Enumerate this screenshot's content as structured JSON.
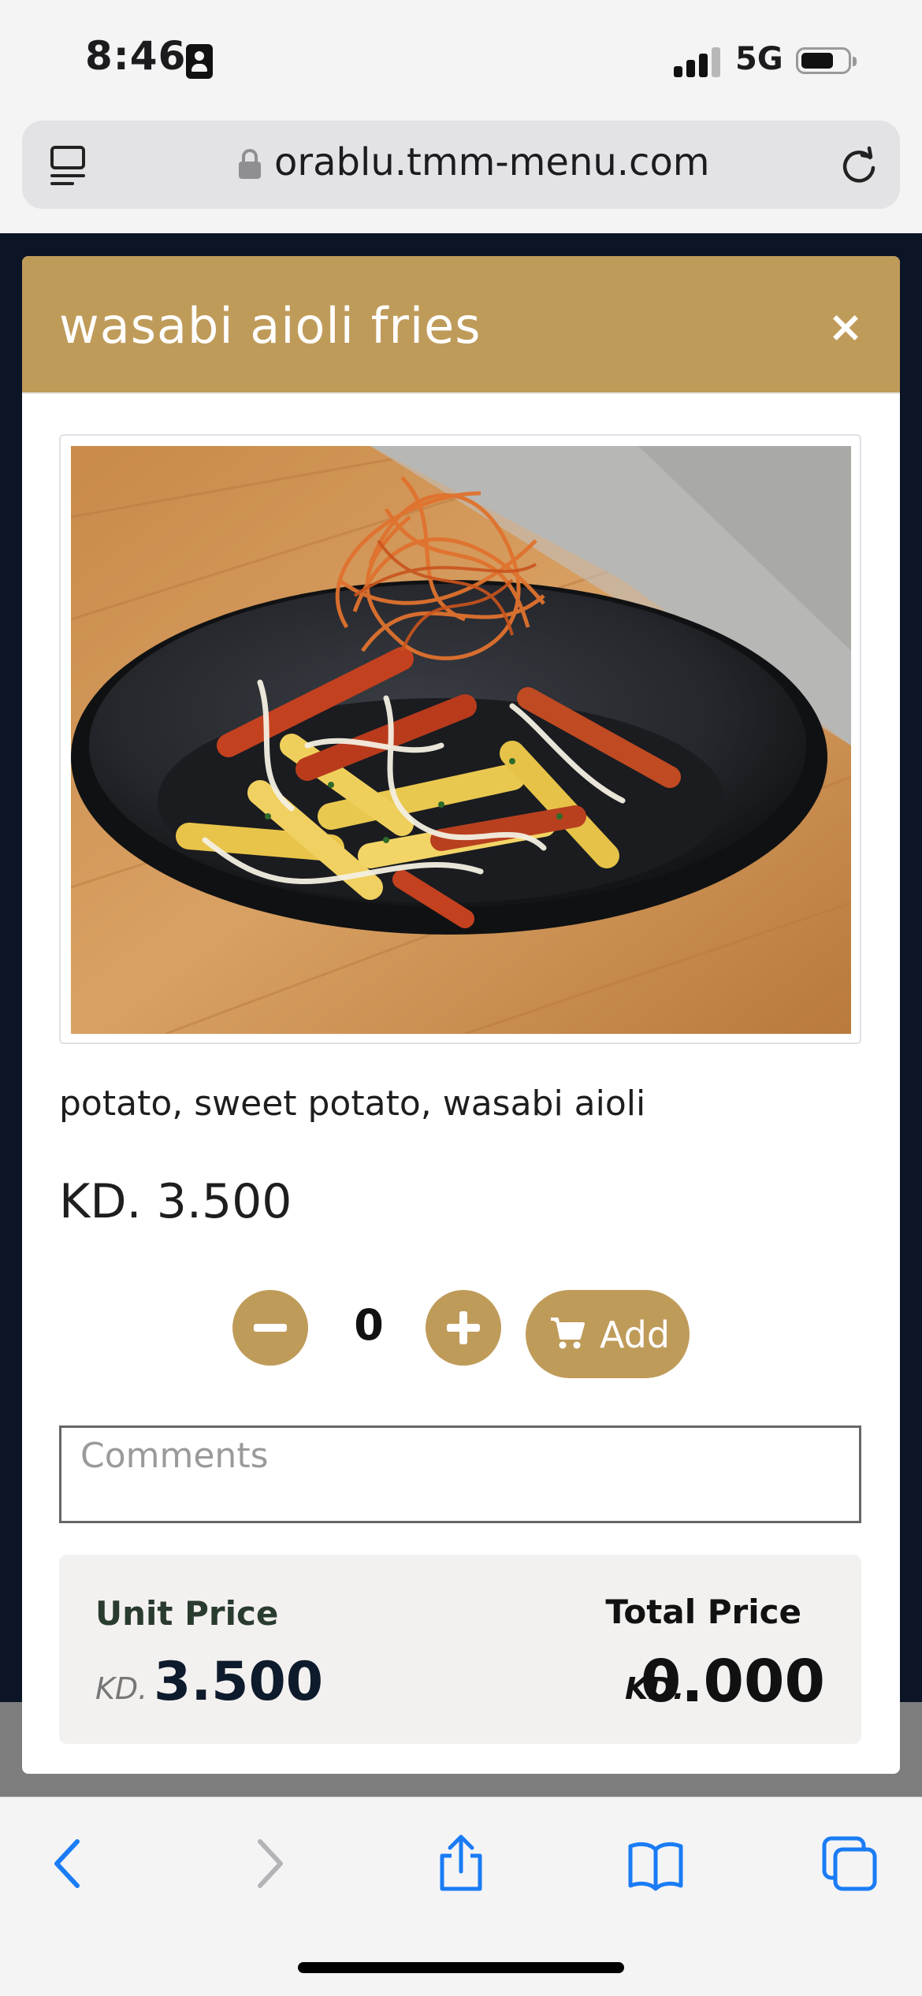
{
  "status_bar": {
    "time": "8:46",
    "network": "5G",
    "icons": [
      "contact-card-icon",
      "signal-bars-icon",
      "battery-icon"
    ]
  },
  "browser": {
    "url": "orablu.tmm-menu.com",
    "icons": [
      "reader-icon",
      "lock-icon",
      "reload-icon"
    ]
  },
  "modal": {
    "title": "wasabi aioli fries",
    "close_icon": "×",
    "image_alt": "wasabi aioli fries",
    "description": "potato, sweet potato, wasabi aioli",
    "price": "KD. 3.500",
    "quantity": "0",
    "add_label": "Add",
    "comments_placeholder": "Comments",
    "unit_price_label": "Unit Price",
    "unit_price_currency": "KD.",
    "unit_price_value": "3.500",
    "total_price_label": "Total Price",
    "total_price_currency": "KD.",
    "total_price_value": "0.000"
  },
  "toolbar": {
    "icons": [
      "back-icon",
      "forward-icon",
      "share-icon",
      "bookmarks-icon",
      "tabs-icon"
    ]
  },
  "colors": {
    "accent": "#bf9b5a",
    "ios_blue": "#1a7cf5",
    "page_background": "#0b1526"
  }
}
